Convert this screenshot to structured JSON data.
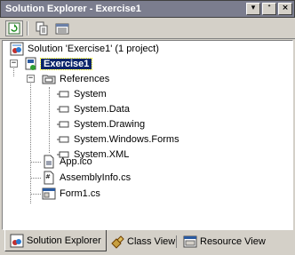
{
  "window": {
    "title": "Solution Explorer - Exercise1"
  },
  "toolbar": {
    "buttons": [
      "refresh-icon",
      "show-all-files-icon",
      "properties-icon"
    ]
  },
  "tree": {
    "solution": "Solution 'Exercise1' (1 project)",
    "project": "Exercise1",
    "references": {
      "label": "References",
      "items": [
        "System",
        "System.Data",
        "System.Drawing",
        "System.Windows.Forms",
        "System.XML"
      ]
    },
    "files": [
      "App.ico",
      "AssemblyInfo.cs",
      "Form1.cs"
    ]
  },
  "tabs": [
    {
      "label": "Solution Explorer",
      "active": true
    },
    {
      "label": "Class View",
      "active": false
    },
    {
      "label": "Resource View",
      "active": false
    }
  ],
  "colors": {
    "title_bar": "#7b7d8e",
    "selection": "#0a246a",
    "face": "#d4d0c8"
  }
}
